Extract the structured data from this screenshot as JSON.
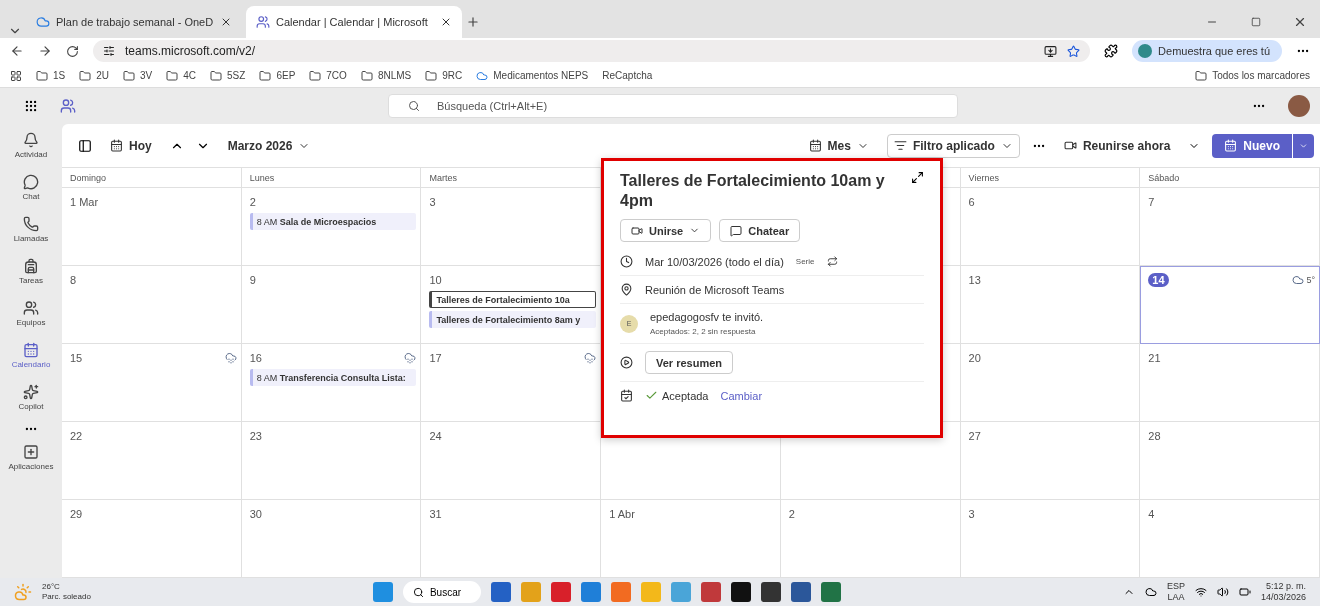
{
  "browser": {
    "tabs": [
      {
        "title": "Plan de trabajo semanal - OneD",
        "selected": false
      },
      {
        "title": "Calendar | Calendar | Microsoft",
        "selected": true
      }
    ],
    "url": "teams.microsoft.com/v2/",
    "profile": "Demuestra que eres tú",
    "bookmarks": [
      "1S",
      "2U",
      "3V",
      "4C",
      "5SZ",
      "6EP",
      "7CO",
      "8NLMS",
      "9RC"
    ],
    "bookmark_links": [
      "Medicamentos NEPS",
      "ReCaptcha"
    ],
    "all_bookmarks": "Todos los marcadores"
  },
  "search": {
    "placeholder": "Búsqueda (Ctrl+Alt+E)"
  },
  "sidebar": {
    "items": [
      {
        "label": "Actividad",
        "selected": false
      },
      {
        "label": "Chat",
        "selected": false
      },
      {
        "label": "Llamadas",
        "selected": false
      },
      {
        "label": "Tareas",
        "selected": false
      },
      {
        "label": "Equipos",
        "selected": false
      },
      {
        "label": "Calendario",
        "selected": true
      },
      {
        "label": "Copilot",
        "selected": false
      }
    ],
    "apps": "Aplicaciones"
  },
  "toolbar": {
    "today": "Hoy",
    "month": "Marzo 2026",
    "view": "Mes",
    "filter": "Filtro aplicado",
    "meet": "Reunirse ahora",
    "new": "Nuevo"
  },
  "weekdays": [
    "Domingo",
    "Lunes",
    "Martes",
    "Viernes",
    "Sábado"
  ],
  "weeks": [
    [
      {
        "label": "1 Mar",
        "today": false,
        "rain": false
      },
      {
        "label": "2",
        "today": false,
        "rain": false,
        "events": [
          {
            "time": "8 AM",
            "title": "Sala de Microespacios",
            "selected": false
          }
        ]
      },
      {
        "label": "3",
        "today": false,
        "rain": false
      },
      {
        "label": "6",
        "today": false,
        "rain": false
      },
      {
        "label": "7",
        "today": false,
        "rain": false
      }
    ],
    [
      {
        "label": "8",
        "today": false,
        "rain": false
      },
      {
        "label": "9",
        "today": false,
        "rain": false
      },
      {
        "label": "10",
        "today": false,
        "rain": false,
        "events": [
          {
            "title": "Talleres de Fortalecimiento 10a",
            "selected": true
          },
          {
            "title": "Talleres de Fortalecimiento 8am y",
            "selected": false
          }
        ]
      },
      {
        "label": "13",
        "today": false,
        "rain": false
      },
      {
        "label": "14",
        "today": true,
        "rain": false,
        "temp": "5°"
      }
    ],
    [
      {
        "label": "15",
        "today": false,
        "rain": true
      },
      {
        "label": "16",
        "today": false,
        "rain": true,
        "events": [
          {
            "time": "8 AM",
            "title": "Transferencia Consulta Lista:",
            "selected": false
          }
        ]
      },
      {
        "label": "17",
        "today": false,
        "rain": true
      },
      {
        "label": "20",
        "today": false,
        "rain": false
      },
      {
        "label": "21",
        "today": false,
        "rain": false
      }
    ],
    [
      {
        "label": "22",
        "today": false,
        "rain": false
      },
      {
        "label": "23",
        "today": false,
        "rain": false
      },
      {
        "label": "24",
        "today": false,
        "rain": false
      },
      {
        "label": "27",
        "today": false,
        "rain": false
      },
      {
        "label": "28",
        "today": false,
        "rain": false
      }
    ],
    [
      {
        "label": "29",
        "today": false,
        "rain": false
      },
      {
        "label": "30",
        "today": false,
        "rain": false
      },
      {
        "label": "31",
        "today": false,
        "rain": false
      },
      {
        "label": "1 Abr",
        "today": false,
        "rain": false
      },
      {
        "label": "2",
        "today": false,
        "rain": false
      },
      {
        "label": "3",
        "today": false,
        "rain": false
      },
      {
        "label": "4",
        "today": false,
        "rain": false
      }
    ]
  ],
  "popup": {
    "title": "Talleres de Fortalecimiento 10am y 4pm",
    "join": "Unirse",
    "chat": "Chatear",
    "date": "Mar 10/03/2026 (todo el día)",
    "series": "Serie",
    "location": "Reunión de Microsoft Teams",
    "initial": "E",
    "invited": "epedagogosfv te invitó.",
    "responses": "Aceptados: 2, 2 sin respuesta",
    "summary": "Ver resumen",
    "status": "Aceptada",
    "change": "Cambiar"
  },
  "taskbar": {
    "temp": "26°C",
    "weather": "Parc. soleado",
    "search": "Buscar",
    "lang": "ESP",
    "region": "LAA",
    "time": "5:12 p. m.",
    "date": "14/03/2026"
  }
}
